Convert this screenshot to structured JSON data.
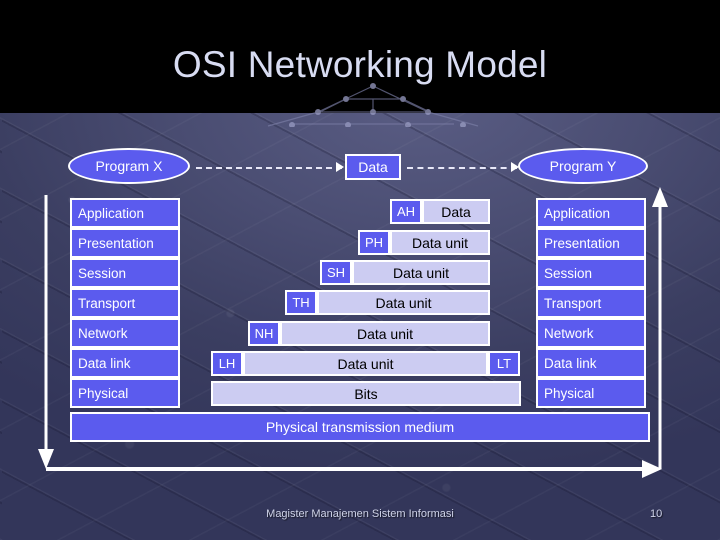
{
  "slide": {
    "title": "OSI Networking Model",
    "footer": "Magister Manajemen Sistem Informasi",
    "page_number": "10",
    "colors": {
      "accent_blue": "#5b5bee",
      "light_lavender": "#ccccf2",
      "outline_white": "#ffffff",
      "title_text": "#d8dcf2",
      "background": "#4a4d72",
      "header_band": "#000000"
    }
  },
  "top_row": {
    "program_left": "Program X",
    "data_box": "Data",
    "program_right": "Program Y"
  },
  "left_stack": {
    "layers": [
      {
        "label": "Application"
      },
      {
        "label": "Presentation"
      },
      {
        "label": "Session"
      },
      {
        "label": "Transport"
      },
      {
        "label": "Network"
      },
      {
        "label": "Data link"
      },
      {
        "label": "Physical"
      }
    ]
  },
  "right_stack": {
    "layers": [
      {
        "label": "Application"
      },
      {
        "label": "Presentation"
      },
      {
        "label": "Session"
      },
      {
        "label": "Transport"
      },
      {
        "label": "Network"
      },
      {
        "label": "Data link"
      },
      {
        "label": "Physical"
      }
    ]
  },
  "pdu_rows": [
    {
      "header": "AH",
      "payload": "Data",
      "trailer": ""
    },
    {
      "header": "PH",
      "payload": "Data unit",
      "trailer": ""
    },
    {
      "header": "SH",
      "payload": "Data unit",
      "trailer": ""
    },
    {
      "header": "TH",
      "payload": "Data unit",
      "trailer": ""
    },
    {
      "header": "NH",
      "payload": "Data unit",
      "trailer": ""
    },
    {
      "header": "LH",
      "payload": "Data unit",
      "trailer": "LT"
    },
    {
      "header": "",
      "payload": "Bits",
      "trailer": ""
    }
  ],
  "medium_bar": {
    "label": "Physical transmission medium"
  }
}
